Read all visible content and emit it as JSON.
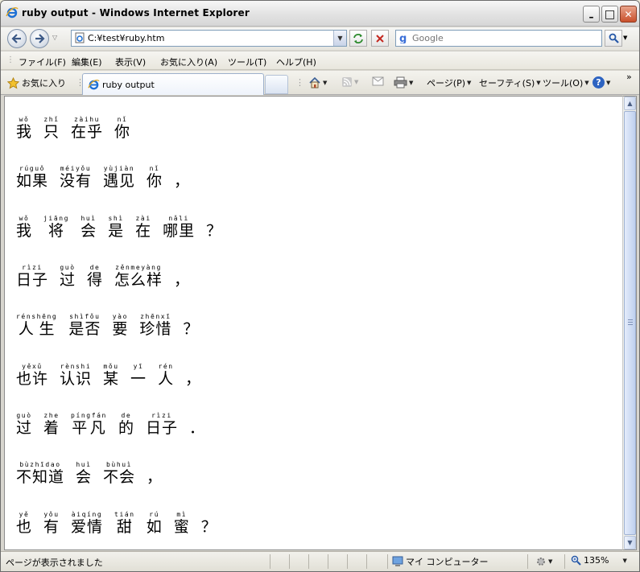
{
  "window": {
    "title": "ruby output - Windows Internet Explorer",
    "minimize_glyph": "–",
    "maximize_glyph": "□",
    "close_glyph": "✕"
  },
  "address": {
    "url": "C:¥test¥ruby.htm"
  },
  "search": {
    "placeholder": "Google"
  },
  "menu": [
    "ファイル(F)",
    "編集(E)",
    "表示(V)",
    "お気に入り(A)",
    "ツール(T)",
    "ヘルプ(H)"
  ],
  "favorites_label": "お気に入り",
  "tab": {
    "label": "ruby output"
  },
  "toolbar": {
    "page": "ページ(P)",
    "safety": "セーフティ(S)",
    "tools": "ツール(O)",
    "help": "?",
    "chevron": "»"
  },
  "content": {
    "lines": [
      {
        "words": [
          {
            "rb": "我",
            "rt": "wǒ"
          },
          {
            "rb": "只",
            "rt": "zhǐ"
          },
          {
            "rb": "在乎",
            "rt": "zàihu"
          },
          {
            "rb": "你",
            "rt": "nǐ"
          }
        ],
        "punct": ""
      },
      {
        "words": [
          {
            "rb": "如果",
            "rt": "rúguǒ"
          },
          {
            "rb": "没有",
            "rt": "méiyǒu"
          },
          {
            "rb": "遇见",
            "rt": "yùjiàn"
          },
          {
            "rb": "你",
            "rt": "nǐ"
          }
        ],
        "punct": "，"
      },
      {
        "words": [
          {
            "rb": "我",
            "rt": "wǒ"
          },
          {
            "rb": "将",
            "rt": "jiāng"
          },
          {
            "rb": "会",
            "rt": "huì"
          },
          {
            "rb": "是",
            "rt": "shì"
          },
          {
            "rb": "在",
            "rt": "zài"
          },
          {
            "rb": "哪里",
            "rt": "nǎli"
          }
        ],
        "punct": "？"
      },
      {
        "words": [
          {
            "rb": "日子",
            "rt": "rìzi"
          },
          {
            "rb": "过",
            "rt": "guò"
          },
          {
            "rb": "得",
            "rt": "de"
          },
          {
            "rb": "怎么样",
            "rt": "zěnmeyàng"
          }
        ],
        "punct": "，"
      },
      {
        "words": [
          {
            "rb": "人生",
            "rt": "rénshēng"
          },
          {
            "rb": "是否",
            "rt": "shìfǒu"
          },
          {
            "rb": "要",
            "rt": "yào"
          },
          {
            "rb": "珍惜",
            "rt": "zhēnxī"
          }
        ],
        "punct": "？"
      },
      {
        "words": [
          {
            "rb": "也许",
            "rt": "yěxǔ"
          },
          {
            "rb": "认识",
            "rt": "rènshi"
          },
          {
            "rb": "某",
            "rt": "mǒu"
          },
          {
            "rb": "一",
            "rt": "yī"
          },
          {
            "rb": "人",
            "rt": "rén"
          }
        ],
        "punct": "，"
      },
      {
        "words": [
          {
            "rb": "过",
            "rt": "guò"
          },
          {
            "rb": "着",
            "rt": "zhe"
          },
          {
            "rb": "平凡",
            "rt": "píngfán"
          },
          {
            "rb": "的",
            "rt": "de"
          },
          {
            "rb": "日子",
            "rt": "rìzi"
          }
        ],
        "punct": "．"
      },
      {
        "words": [
          {
            "rb": "不知道",
            "rt": "bùzhīdao"
          },
          {
            "rb": "会",
            "rt": "huì"
          },
          {
            "rb": "不会",
            "rt": "bùhuì"
          }
        ],
        "punct": "，"
      },
      {
        "words": [
          {
            "rb": "也",
            "rt": "yě"
          },
          {
            "rb": "有",
            "rt": "yǒu"
          },
          {
            "rb": "爱情",
            "rt": "àiqíng"
          },
          {
            "rb": "甜",
            "rt": "tián"
          },
          {
            "rb": "如",
            "rt": "rú"
          },
          {
            "rb": "蜜",
            "rt": "mì"
          }
        ],
        "punct": "？"
      }
    ]
  },
  "status": {
    "text": "ページが表示されました",
    "zone": "マイ コンピューター",
    "zoom": "135%"
  },
  "colors": {
    "ie_blue": "#1c6fd4",
    "close_red": "#c9502b"
  }
}
